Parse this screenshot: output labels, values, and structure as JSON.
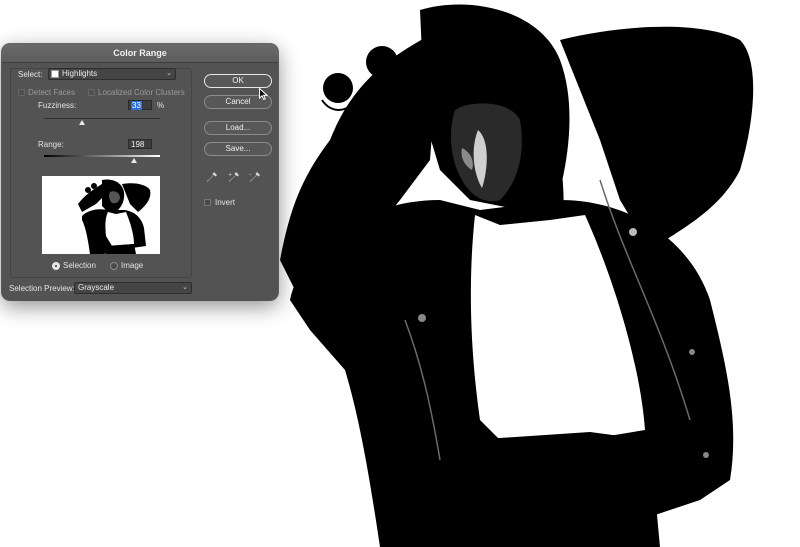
{
  "dialog": {
    "title": "Color Range",
    "select_label": "Select:",
    "select_value": "Highlights",
    "detect_faces_label": "Detect Faces",
    "localized_clusters_label": "Localized Color Clusters",
    "fuzziness_label": "Fuzziness:",
    "fuzziness_value": "33",
    "fuzziness_unit": "%",
    "range_label": "Range:",
    "range_value": "198",
    "view_selection_label": "Selection",
    "view_image_label": "Image",
    "selection_preview_label": "Selection Preview:",
    "selection_preview_value": "Grayscale",
    "buttons": {
      "ok": "OK",
      "cancel": "Cancel",
      "load": "Load...",
      "save": "Save..."
    },
    "invert_label": "Invert",
    "fuzziness_level_percent": 33,
    "range_level": 198,
    "range_max": 255
  },
  "icons": {
    "eyedropper": "eyedropper-icon",
    "eyedropper_add": "eyedropper-plus-icon",
    "eyedropper_subtract": "eyedropper-minus-icon"
  },
  "colors": {
    "dialog_bg": "#535353",
    "highlight": "#2d6fd0"
  }
}
